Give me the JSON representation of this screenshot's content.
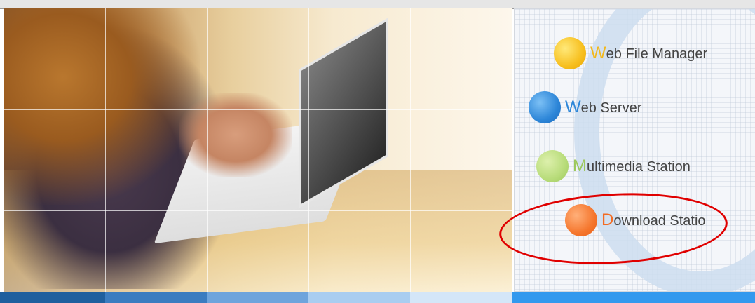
{
  "colors": {
    "label_text": "#444444",
    "annotation": "#e00000",
    "bottom_bar": [
      "#1f5f9e",
      "#3b7cc0",
      "#6ea4dc",
      "#a9cdf0",
      "#d4e6f8",
      "#3399ee"
    ]
  },
  "menu": {
    "items": [
      {
        "first_letter": "W",
        "rest": "eb File Manager",
        "first_color": "#f2b81b",
        "icon": "yellow-ball-icon"
      },
      {
        "first_letter": "W",
        "rest": "eb Server",
        "first_color": "#2d86d8",
        "icon": "blue-ball-icon"
      },
      {
        "first_letter": "M",
        "rest": "ultimedia Station",
        "first_color": "#9cc85c",
        "icon": "green-ball-icon"
      },
      {
        "first_letter": "D",
        "rest": "ownload Statio",
        "first_color": "#f36b22",
        "icon": "orange-ball-icon"
      }
    ]
  }
}
